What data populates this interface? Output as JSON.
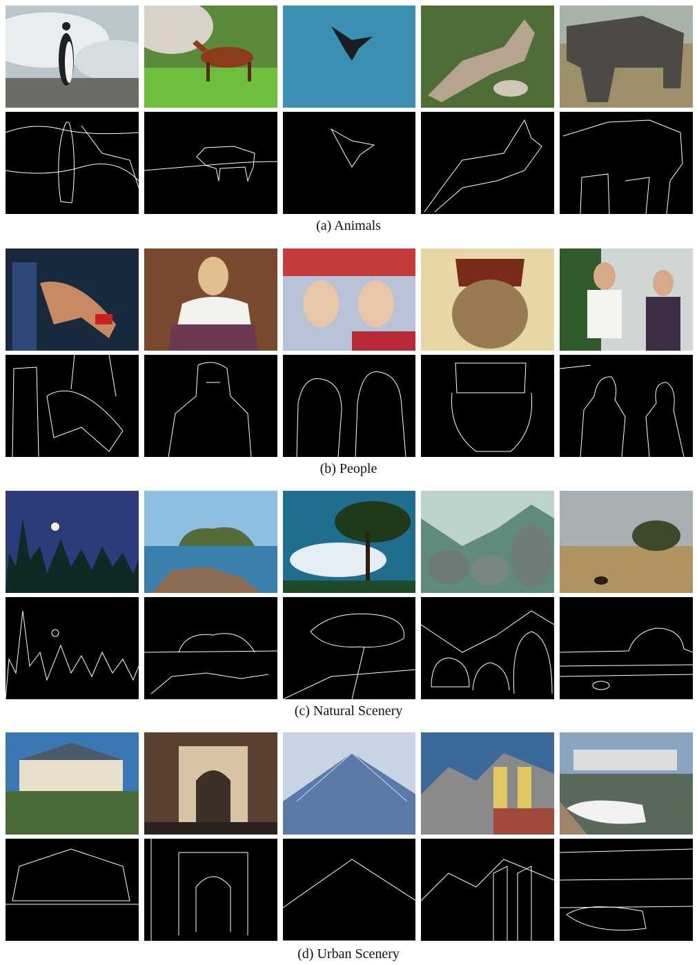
{
  "groups": [
    {
      "id": "animals",
      "caption": "(a)  Animals",
      "images": [
        "penguin",
        "horse",
        "eagle",
        "kangaroo",
        "elephant"
      ]
    },
    {
      "id": "people",
      "caption": "(b)  People",
      "images": [
        "swimmer",
        "woman",
        "two-women",
        "man-fez",
        "couple"
      ]
    },
    {
      "id": "natural",
      "caption": "(c) Natural Scenery",
      "images": [
        "moon-trees",
        "rock-island",
        "tree-sky",
        "valley-rocks",
        "field-tree"
      ]
    },
    {
      "id": "urban",
      "caption": "(d) Urban Scenery",
      "images": [
        "chateau",
        "arch",
        "glass-pyramid",
        "church-towers",
        "boat-building"
      ]
    }
  ],
  "colors": {
    "edge_background": "#000000",
    "edge_line": "#ffffff",
    "page": "#ffffff"
  }
}
